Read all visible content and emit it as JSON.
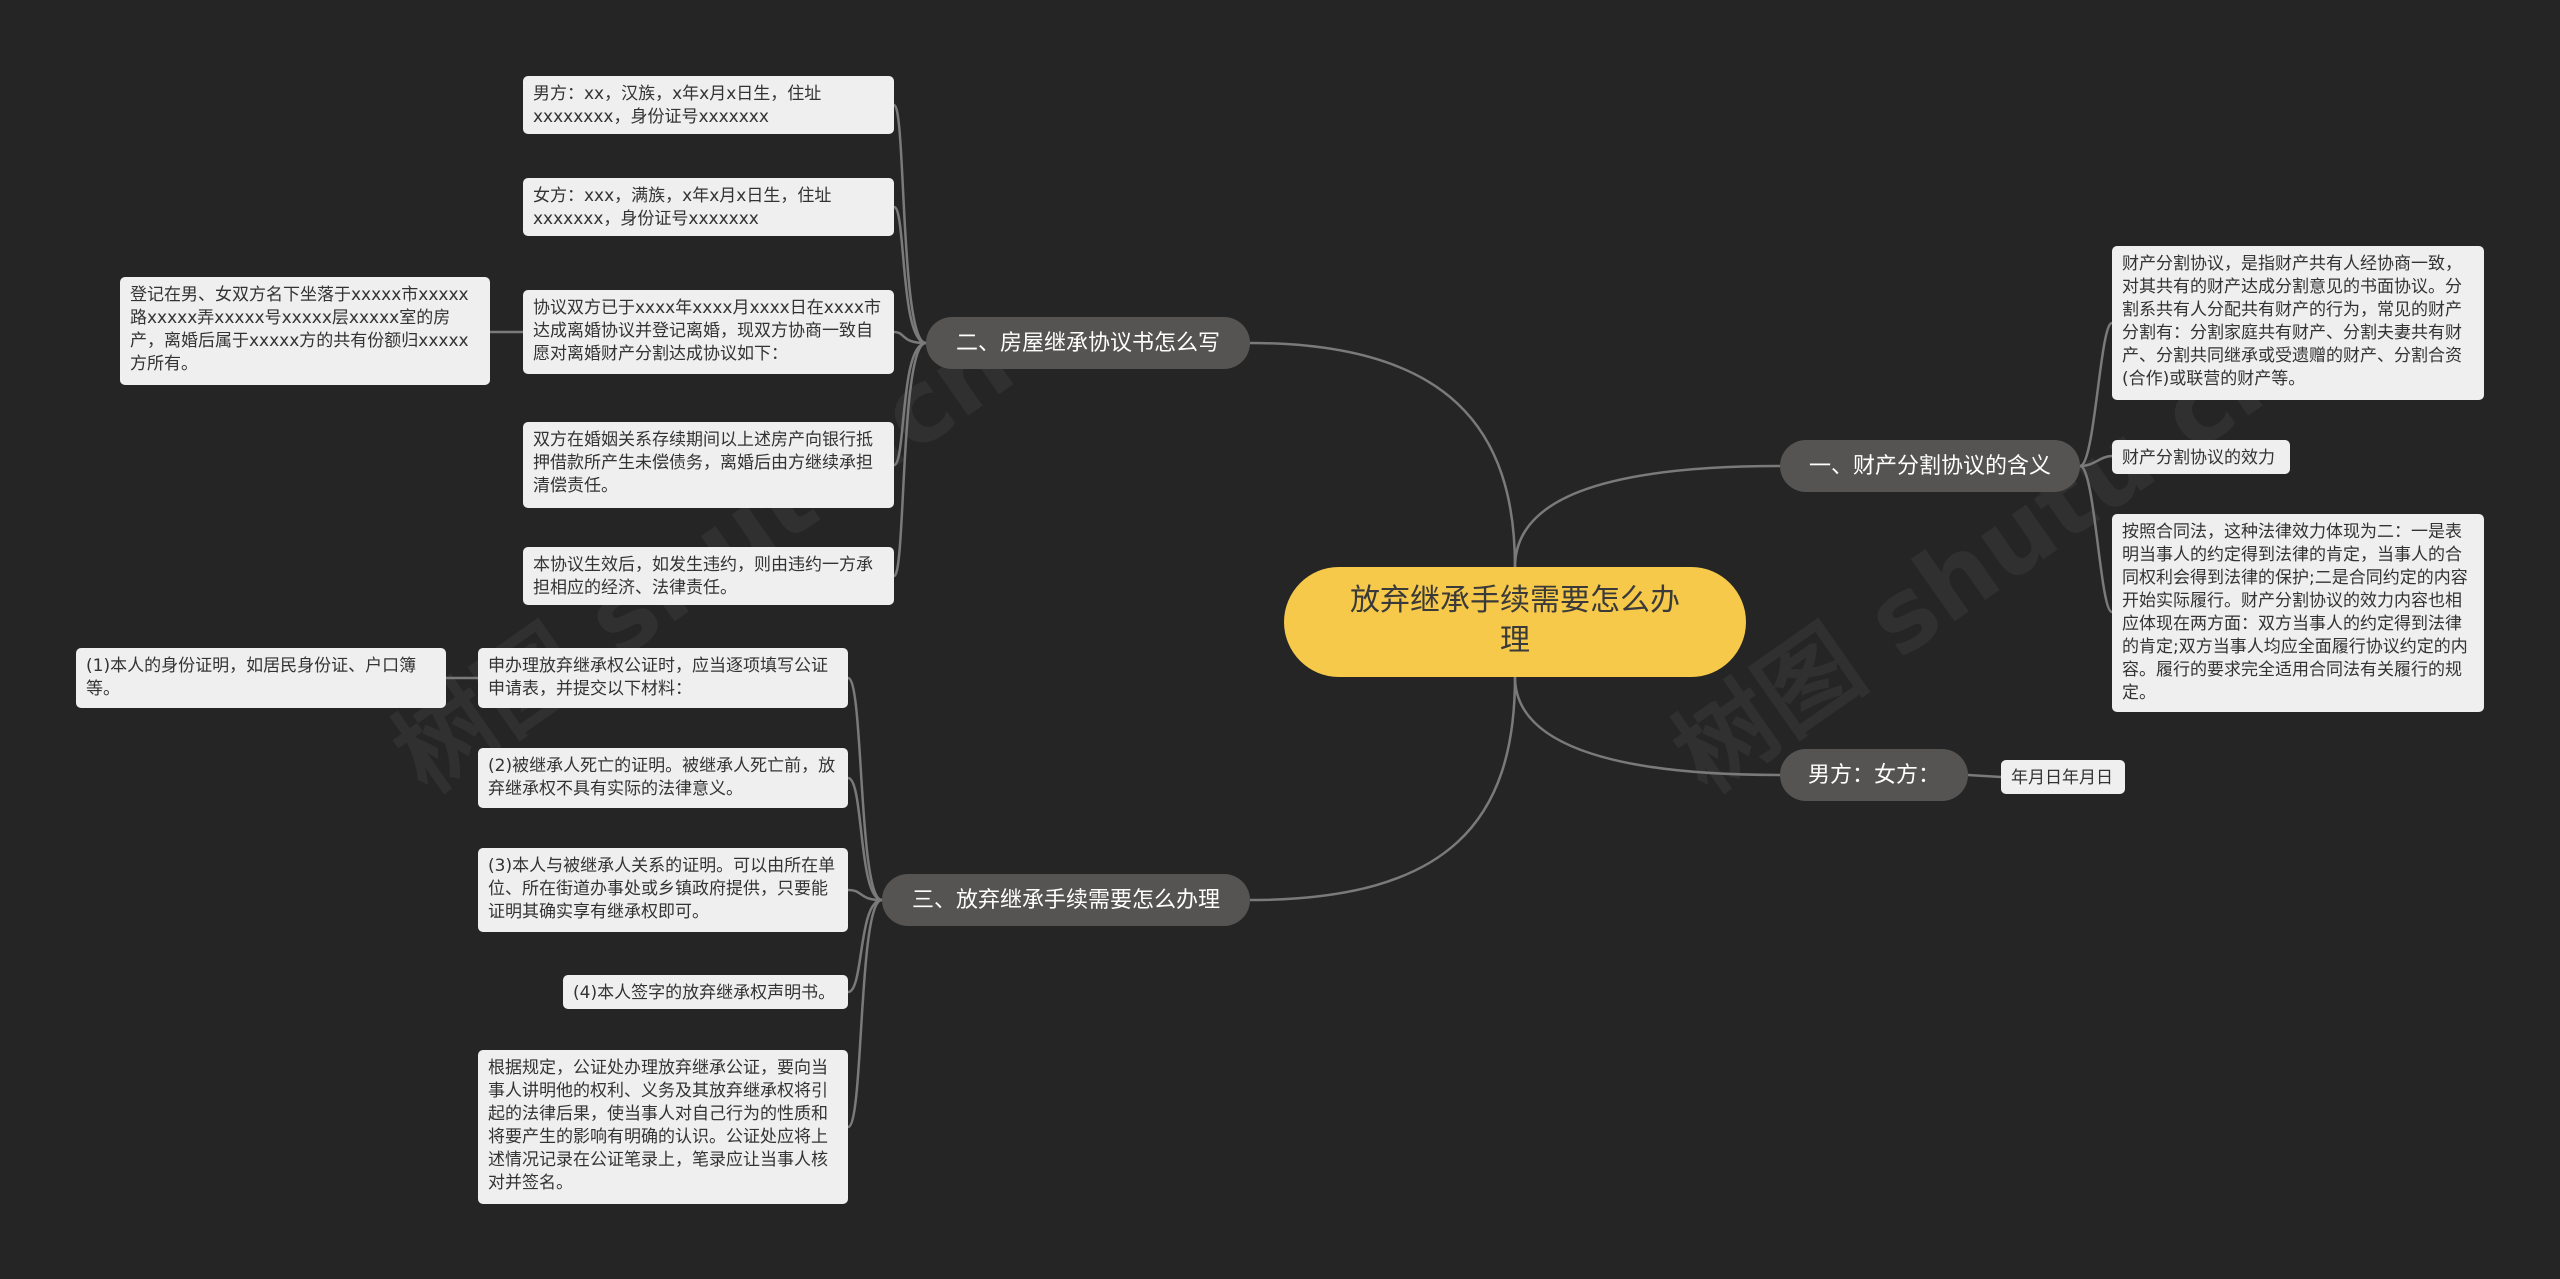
{
  "root": {
    "label": "放弃继承手续需要怎么办理"
  },
  "branches": {
    "b1": {
      "label": "一、财产分割协议的含义"
    },
    "b2": {
      "label": "男方：女方："
    },
    "b3": {
      "label": "二、房屋继承协议书怎么写"
    },
    "b4": {
      "label": "三、放弃继承手续需要怎么办理"
    }
  },
  "leaves": {
    "r1": "财产分割协议，是指财产共有人经协商一致，对其共有的财产达成分割意见的书面协议。分割系共有人分配共有财产的行为，常见的财产分割有：分割家庭共有财产、分割夫妻共有财产、分割共同继承或受遗赠的财产、分割合资(合作)或联营的财产等。",
    "r2": "财产分割协议的效力",
    "r3": "按照合同法，这种法律效力体现为二：一是表明当事人的约定得到法律的肯定，当事人的合同权利会得到法律的保护;二是合同约定的内容开始实际履行。财产分割协议的效力内容也相应体现在两方面：双方当事人的约定得到法律的肯定;双方当事人均应全面履行协议约定的内容。履行的要求完全适用合同法有关履行的规定。",
    "r4": "年月日年月日",
    "a1": "男方：xx，汉族，x年x月x日生，住址xxxxxxxx，身份证号xxxxxxx",
    "a2": "女方：xxx，满族，x年x月x日生，住址xxxxxxx，身份证号xxxxxxx",
    "a3": "协议双方已于xxxx年xxxx月xxxx日在xxxx市达成离婚协议并登记离婚，现双方协商一致自愿对离婚财产分割达成协议如下：",
    "a3sub": "登记在男、女双方名下坐落于xxxxx市xxxxx路xxxxx弄xxxxx号xxxxx层xxxxx室的房产，离婚后属于xxxxx方的共有份额归xxxxx方所有。",
    "a4": "双方在婚姻关系存续期间以上述房产向银行抵押借款所产生未偿债务，离婚后由方继续承担清偿责任。",
    "a5": "本协议生效后，如发生违约，则由违约一方承担相应的经济、法律责任。",
    "c1": "申办理放弃继承权公证时，应当逐项填写公证申请表，并提交以下材料：",
    "c1sub": "(1)本人的身份证明，如居民身份证、户口簿等。",
    "c2": "(2)被继承人死亡的证明。被继承人死亡前，放弃继承权不具有实际的法律意义。",
    "c3": "(3)本人与被继承人关系的证明。可以由所在单位、所在街道办事处或乡镇政府提供，只要能证明其确实享有继承权即可。",
    "c4": "(4)本人签字的放弃继承权声明书。",
    "c5": "根据规定，公证处办理放弃继承公证，要向当事人讲明他的权利、义务及其放弃继承权将引起的法律后果，使当事人对自己行为的性质和将要产生的影响有明确的认识。公证处应将上述情况记录在公证笔录上，笔录应让当事人核对并签名。"
  },
  "watermark": {
    "text": "树图 shutu.cn"
  },
  "colors": {
    "background": "#252525",
    "root": "#f6c94a",
    "branch": "#555453",
    "leaf": "#efefef",
    "connector": "#7a7a7a"
  }
}
